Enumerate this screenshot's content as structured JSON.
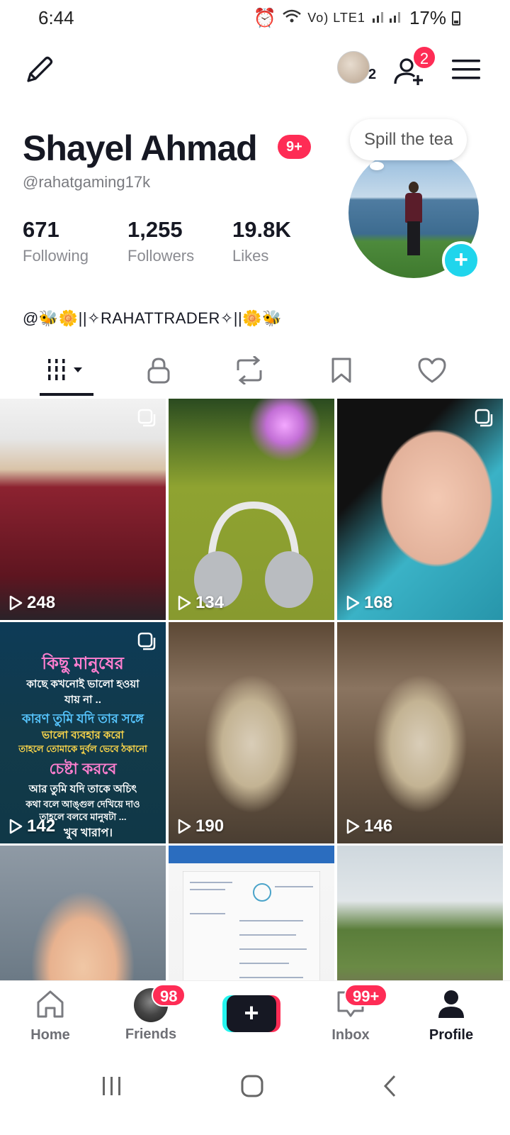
{
  "status_bar": {
    "time": "6:44",
    "network": "Vo) LTE1",
    "battery": "17%"
  },
  "top_bar": {
    "avatar_count": "2",
    "friend_requests_badge": "2"
  },
  "profile": {
    "display_name": "Shayel Ahmad",
    "notification_badge": "9+",
    "username": "@rahatgaming17k",
    "note": "Spill the tea",
    "bio": "@🐝🌼||✧RAHATTRADER✧||🌼🐝"
  },
  "stats": [
    {
      "value": "671",
      "label": "Following"
    },
    {
      "value": "1,255",
      "label": "Followers"
    },
    {
      "value": "19.8K",
      "label": "Likes"
    }
  ],
  "tabs": [
    "videos",
    "private",
    "reposts",
    "favorites",
    "liked"
  ],
  "videos": [
    {
      "views": "248",
      "multi": true
    },
    {
      "views": "134",
      "multi": false
    },
    {
      "views": "168",
      "multi": true
    },
    {
      "views": "142",
      "multi": true,
      "caption_lines": [
        "কিছু মানুষের",
        "কাছে কখনোই ভালো হওয়া",
        "যায় না ..",
        "কারণ তুমি যদি তার সঙ্গে",
        "ভালো ব্যবহার করো",
        "তাহলে তোমাকে দুর্বল ভেবে ঠকানো",
        "চেষ্টা করবে",
        "আর তুমি যদি তাকে অচিৎ",
        "কথা বলে আঙ্গুল দেখিয়ে দাও",
        "তাহলে বলবে মানুষটা ...",
        "খুব খারাপ।"
      ]
    },
    {
      "views": "190",
      "multi": false
    },
    {
      "views": "146",
      "multi": false
    },
    {
      "views": "",
      "multi": false
    },
    {
      "views": "",
      "multi": false
    },
    {
      "views": "",
      "multi": false
    }
  ],
  "bottom_nav": {
    "home": "Home",
    "friends": "Friends",
    "friends_badge": "98",
    "inbox": "Inbox",
    "inbox_badge": "99+",
    "profile": "Profile"
  },
  "colors": {
    "accent": "#fe2c55",
    "cyan": "#25f4ee",
    "text": "#161823",
    "secondary_text": "#8a8b91"
  }
}
